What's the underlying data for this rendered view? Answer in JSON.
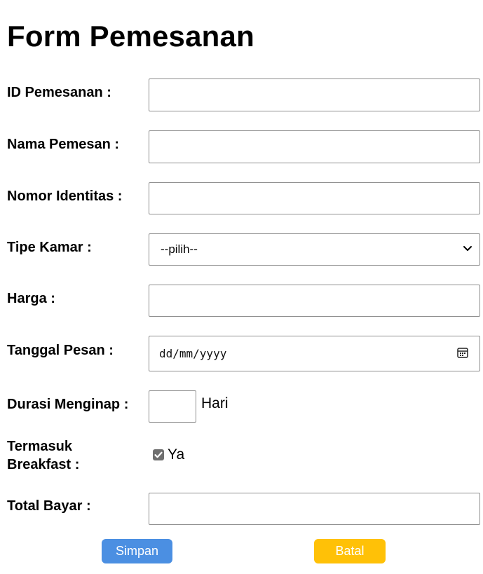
{
  "form": {
    "title": "Form Pemesanan",
    "fields": {
      "id_pemesanan": {
        "label": "ID Pemesanan :",
        "value": ""
      },
      "nama_pemesan": {
        "label": "Nama Pemesan :",
        "value": ""
      },
      "nomor_identitas": {
        "label": "Nomor Identitas :",
        "value": ""
      },
      "tipe_kamar": {
        "label": "Tipe Kamar :",
        "selected": "--pilih--"
      },
      "harga": {
        "label": "Harga :",
        "value": ""
      },
      "tanggal_pesan": {
        "label": "Tanggal Pesan :",
        "placeholder": "dd/mm/yyyy"
      },
      "durasi_menginap": {
        "label": "Durasi Menginap :",
        "value": "",
        "suffix": "Hari"
      },
      "termasuk_breakfast": {
        "label_line1": "Termasuk",
        "label_line2": "Breakfast :",
        "option_label": "Ya",
        "checked": true
      },
      "total_bayar": {
        "label": "Total Bayar :",
        "value": ""
      }
    },
    "buttons": {
      "save_label": "Simpan",
      "cancel_label": "Batal"
    }
  },
  "icons": {
    "select_chevron": "chevron-down-icon",
    "date_picker": "calendar-icon",
    "checkbox_mark": "check-icon"
  },
  "colors": {
    "save_button": "#4b8fe2",
    "cancel_button": "#ffc107",
    "checkbox_fill": "#6f6f6f",
    "field_border": "#8f8f8f"
  }
}
